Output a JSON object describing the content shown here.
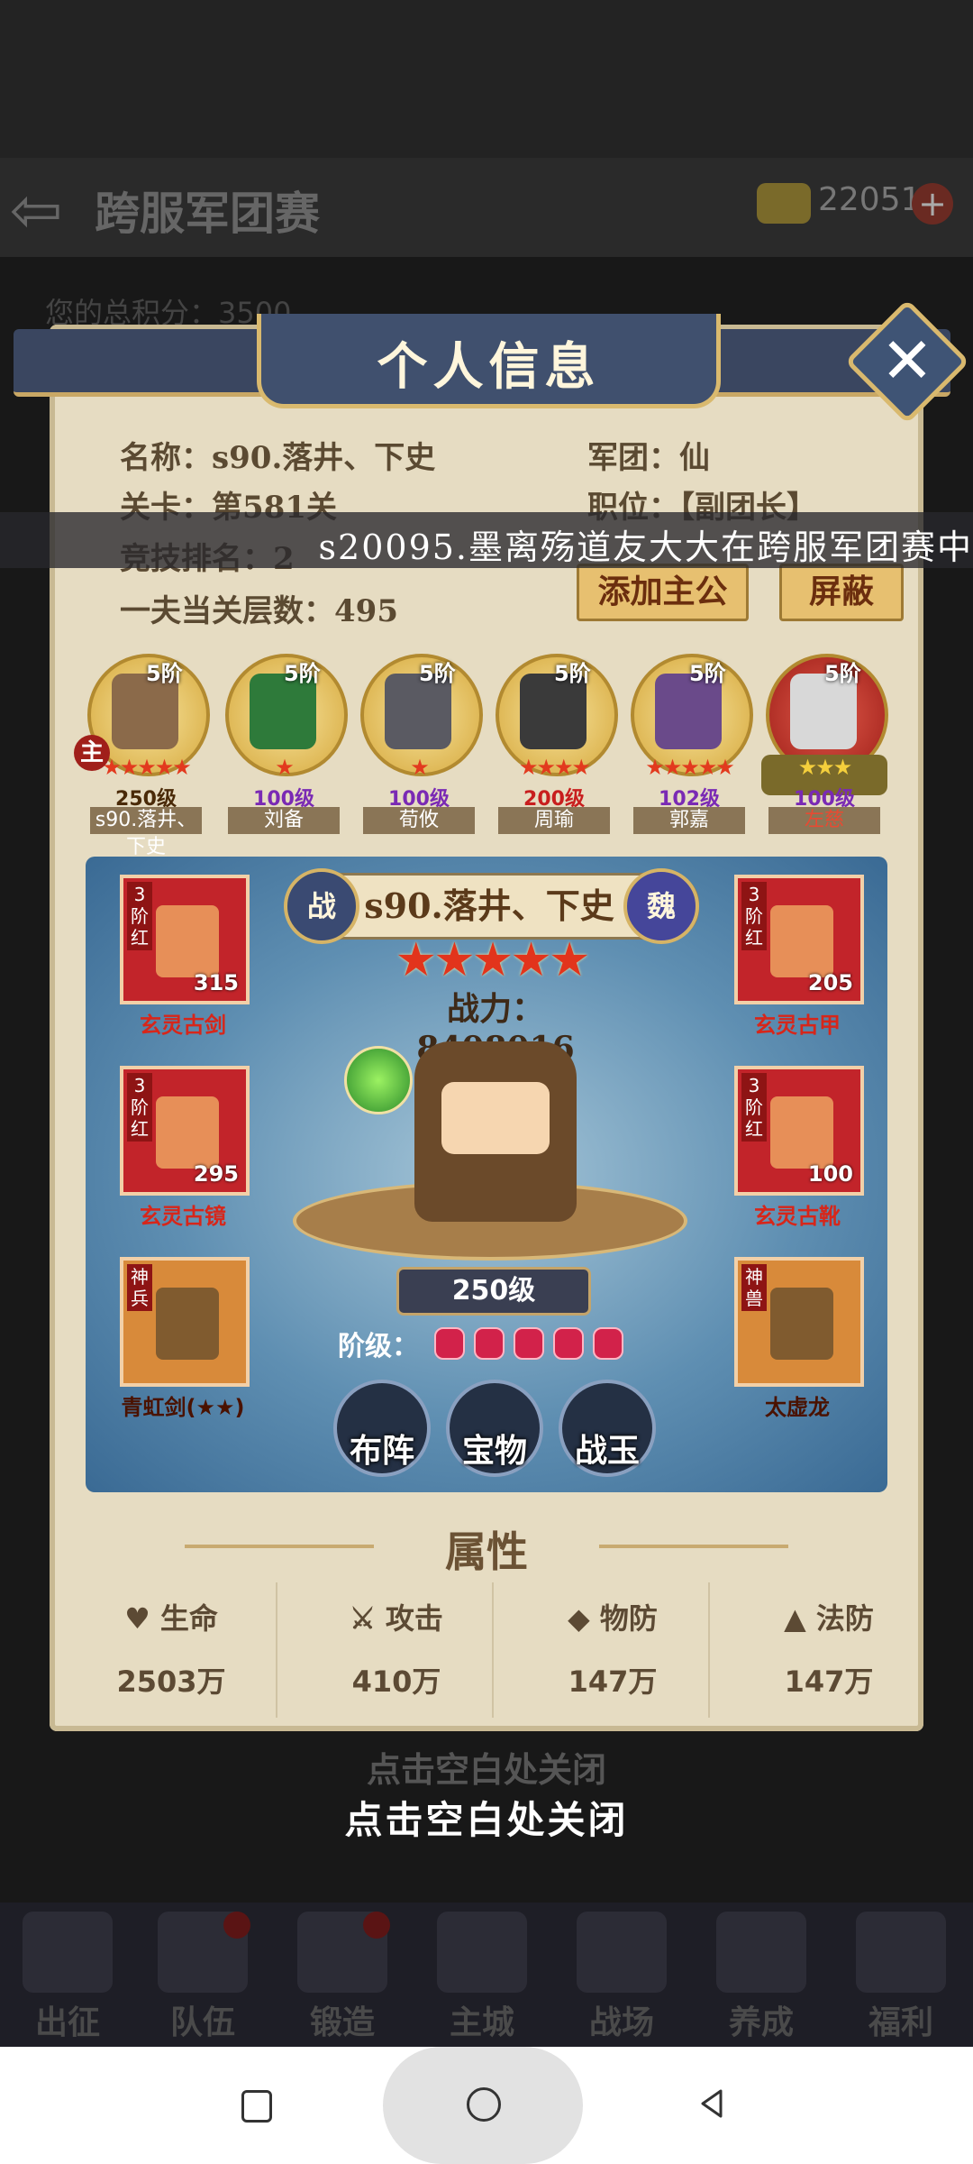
{
  "background": {
    "title": "跨服军团赛",
    "gold": "22051",
    "score_label": "您的总积分",
    "score": "3500",
    "nav": [
      "出征",
      "队伍",
      "锻造",
      "主城",
      "战场",
      "养成",
      "福利"
    ]
  },
  "dialog": {
    "title": "个人信息",
    "info": {
      "name_label": "名称：",
      "name": "s90.落井、下史",
      "legion_label": "军团：",
      "legion": "仙",
      "stage_label": "关卡：",
      "stage": "第581关",
      "role_label": "职位：",
      "role": "【副团长】",
      "arena_label": "竞技排名：",
      "arena_rank": "2",
      "tower_label": "一夫当关层数：",
      "tower": "495"
    },
    "buttons": {
      "add_lord": "添加主公",
      "block": "屏蔽"
    },
    "marquee": "s20095.墨离殇道友大大在跨服军团赛中",
    "main_badge": "主",
    "heroes": [
      {
        "rank": "5阶",
        "stars": "★★★★★",
        "level": "250级",
        "name": "s90.落井、下史"
      },
      {
        "rank": "5阶",
        "stars": "★",
        "level": "100级",
        "name": "刘备"
      },
      {
        "rank": "5阶",
        "stars": "★",
        "level": "100级",
        "name": "荀攸"
      },
      {
        "rank": "5阶",
        "stars": "★★★★",
        "level": "200级",
        "name": "周瑜"
      },
      {
        "rank": "5阶",
        "stars": "★★★★★",
        "level": "102级",
        "name": "郭嘉"
      },
      {
        "rank": "5阶",
        "stars": "★★★",
        "level": "100级",
        "name": "左慈"
      }
    ],
    "detail": {
      "badge_left": "战",
      "name": "s90.落井、下史",
      "badge_right": "魏",
      "stars": "★★★★★",
      "power": "战力：8408016",
      "level": "250级",
      "stage_label": "阶级："
    },
    "equipment": [
      {
        "tag": "3阶红",
        "value": "315",
        "label": "玄灵古剑"
      },
      {
        "tag": "3阶红",
        "value": "295",
        "label": "玄灵古镜"
      },
      {
        "tag": "神兵",
        "value": "",
        "label": "青虹剑(★★)"
      },
      {
        "tag": "3阶红",
        "value": "205",
        "label": "玄灵古甲"
      },
      {
        "tag": "3阶红",
        "value": "100",
        "label": "玄灵古靴"
      },
      {
        "tag": "神兽",
        "value": "",
        "label": "太虚龙"
      }
    ],
    "actions": [
      "布阵",
      "宝物",
      "战玉"
    ],
    "attributes_title": "属性",
    "attributes": [
      {
        "label": "生命",
        "value": "2503万"
      },
      {
        "label": "攻击",
        "value": "410万"
      },
      {
        "label": "物防",
        "value": "147万"
      },
      {
        "label": "法防",
        "value": "147万"
      }
    ],
    "close_hint": "点击空白处关闭"
  }
}
